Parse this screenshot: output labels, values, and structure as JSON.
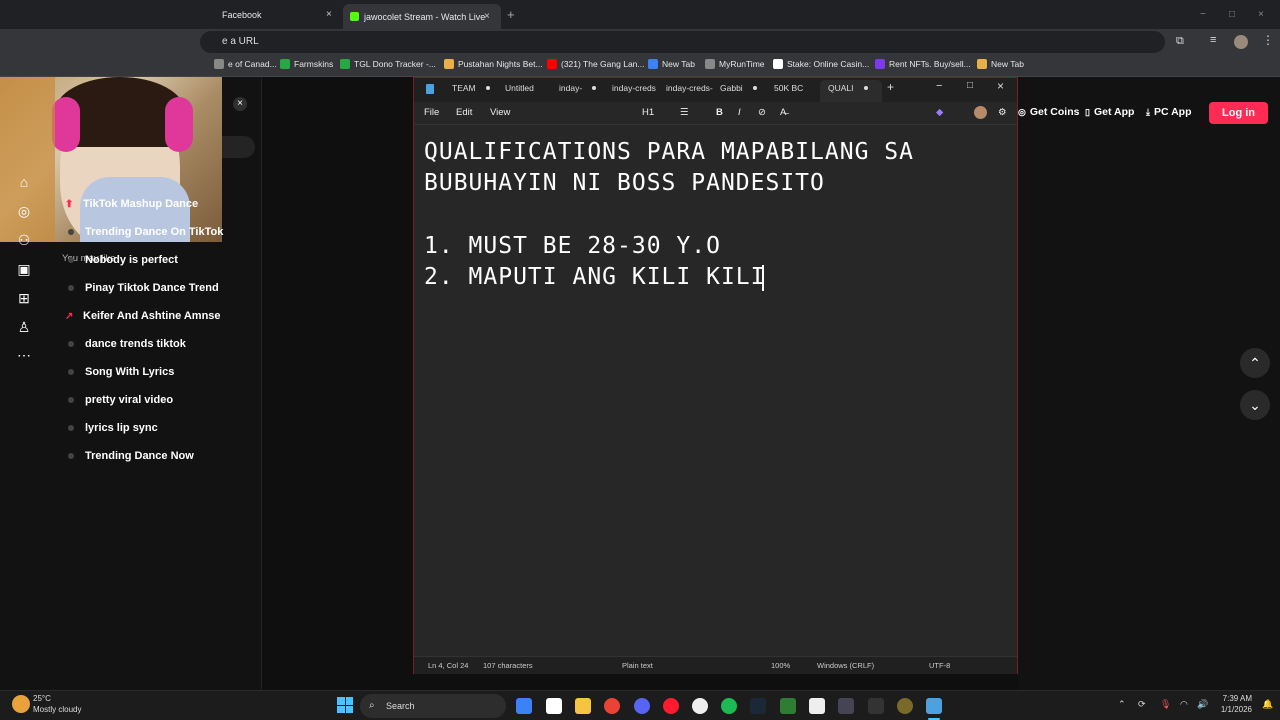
{
  "browser": {
    "tabs": [
      {
        "label": "Facebook",
        "close": "×"
      },
      {
        "label": "jawocolet Stream - Watch Live",
        "close": "×"
      }
    ],
    "new_tab": "+",
    "address_placeholder": "e a URL",
    "bookmarks": [
      {
        "label": "e of Canad...",
        "color": "#888"
      },
      {
        "label": "Farmskins",
        "color": "#28a745"
      },
      {
        "label": "TGL Dono Tracker -...",
        "color": "#28a745"
      },
      {
        "label": "Pustahan Nights Bet...",
        "color": "#e9b04a"
      },
      {
        "label": "(321) The Gang Lan...",
        "color": "#ff0000"
      },
      {
        "label": "New Tab",
        "color": "#3b82f6"
      },
      {
        "label": "MyRunTime",
        "color": "#888"
      },
      {
        "label": "Stake: Online Casin...",
        "color": "#fff"
      },
      {
        "label": "Rent NFTs. Buy/sell...",
        "color": "#7c3aed"
      },
      {
        "label": "New Tab",
        "color": "#e9b04a"
      }
    ]
  },
  "sidebar": {
    "section_title": "You may like",
    "suggestions": [
      {
        "label": "TikTok Mashup Dance",
        "marker": "hot"
      },
      {
        "label": "Trending Dance On TikTok",
        "marker": "dot"
      },
      {
        "label": "Nobody is perfect",
        "marker": "dot"
      },
      {
        "label": "Pinay Tiktok Dance Trend",
        "marker": "dot"
      },
      {
        "label": "Keifer And Ashtine Amnse",
        "marker": "trend"
      },
      {
        "label": "dance trends tiktok",
        "marker": "dot"
      },
      {
        "label": "Song With Lyrics",
        "marker": "dot"
      },
      {
        "label": "pretty viral video",
        "marker": "dot"
      },
      {
        "label": "lyrics lip sync",
        "marker": "dot"
      },
      {
        "label": "Trending Dance Now",
        "marker": "dot"
      }
    ],
    "rail_icons": [
      "home-icon",
      "explore-icon",
      "following-icon",
      "live-icon",
      "upload-icon",
      "profile-icon",
      "more-icon"
    ]
  },
  "header_right": {
    "get_coins": "Get Coins",
    "get_app": "Get App",
    "pc_app": "PC App",
    "login": "Log in"
  },
  "notepad": {
    "tabs": [
      "TEAM",
      "Untitled",
      "inday-",
      "inday-creds",
      "inday-creds-",
      "Gabbi",
      "50K BC",
      "QUALI"
    ],
    "menu": [
      "File",
      "Edit",
      "View"
    ],
    "heading_format": "H1",
    "content_lines": [
      "QUALIFICATIONS PARA MAPABILANG SA",
      "BUBUHAYIN NI BOSS PANDESITO",
      "",
      "1. MUST BE 28-30 Y.O",
      "2. MAPUTI ANG KILI KILI"
    ],
    "status": {
      "position": "Ln 4, Col 24",
      "characters": "107 characters",
      "format": "Plain text",
      "zoom": "100%",
      "line_ending": "Windows (CRLF)",
      "encoding": "UTF-8"
    },
    "window_controls": [
      "−",
      "□",
      "×"
    ]
  },
  "taskbar": {
    "weather_temp": "25°C",
    "weather_desc": "Mostly cloudy",
    "search_label": "Search",
    "time": "7:39 AM",
    "date": "1/1/2026"
  }
}
